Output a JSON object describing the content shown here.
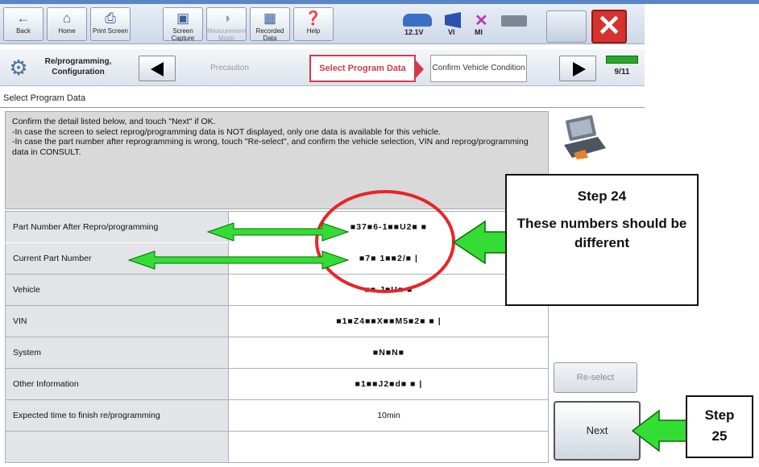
{
  "toolbar": {
    "buttons": [
      {
        "label": "Back",
        "icon": "back-arrow-icon"
      },
      {
        "label": "Home",
        "icon": "home-icon"
      },
      {
        "label": "Print Screen",
        "icon": "printer-icon"
      },
      {
        "label": "Screen Capture",
        "icon": "camera-icon"
      },
      {
        "label": "Measurement Mode",
        "icon": "meter-icon"
      },
      {
        "label": "Recorded Data",
        "icon": "recorded-data-icon"
      },
      {
        "label": "Help",
        "icon": "help-icon"
      }
    ],
    "status": {
      "voltage": "12.1V",
      "vi": "VI",
      "mi": "MI"
    }
  },
  "stepnav": {
    "mode_label": "Re/programming, Configuration",
    "prev_step": "Precaution",
    "current_step": "Select Program Data",
    "next_step": "Confirm Vehicle Condition",
    "progress": "9/11"
  },
  "page_heading": "Select Program Data",
  "instructions": [
    "Confirm the detail listed below, and touch \"Next\" if OK.",
    "-In case the screen to select reprog/programming data is NOT displayed, only one data is available for this vehicle.",
    "-In case the part number after reprogramming is wrong, touch \"Re-select\", and confirm the vehicle selection, VIN and reprog/programming data in CONSULT."
  ],
  "table": [
    {
      "label": "Part Number After Repro/programming",
      "value": "■37■6-1■■U2■  ■"
    },
    {
      "label": "Current Part Number",
      "value": "■7■ 1■■2/■  |"
    },
    {
      "label": "Vehicle",
      "value": "■■ J■U■ ■"
    },
    {
      "label": "VIN",
      "value": "■1■Z4■■X■■M5■2■  ■  |"
    },
    {
      "label": "System",
      "value": "■N■N■"
    },
    {
      "label": "Other Information",
      "value": "■1■■J2■d■  ■  |"
    },
    {
      "label": "Expected time to finish re/programming",
      "value": "10min"
    },
    {
      "label": "",
      "value": ""
    }
  ],
  "buttons": {
    "reselect": "Re-select",
    "next": "Next"
  },
  "callouts": {
    "step24_title": "Step 24",
    "step24_text": "These numbers should be different",
    "step25_line1": "Step",
    "step25_line2": "25"
  },
  "colors": {
    "arrow_green": "#33dd33",
    "circle_red": "#e8242a",
    "current_step_red": "#d43a4a",
    "close_red": "#d6322e"
  }
}
